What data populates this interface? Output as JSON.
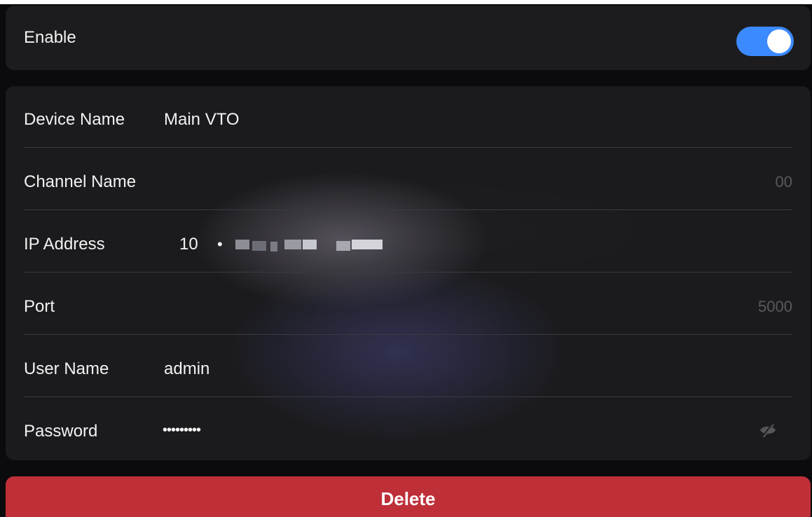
{
  "enable": {
    "label": "Enable",
    "toggle_on": true,
    "toggle_color": "#3b8aff"
  },
  "form": {
    "device_name": {
      "label": "Device Name",
      "value": "Main VTO"
    },
    "channel_name": {
      "label": "Channel Name",
      "value": "",
      "placeholder": "00"
    },
    "ip_address": {
      "label": "IP Address",
      "first_octet": "10",
      "separator": "•"
    },
    "port": {
      "label": "Port",
      "value": "",
      "placeholder": "5000"
    },
    "user_name": {
      "label": "User Name",
      "value": "admin"
    },
    "password": {
      "label": "Password",
      "value": "•••••••••",
      "visibility_icon": "eye-slash-icon"
    }
  },
  "actions": {
    "delete_label": "Delete",
    "delete_color": "#be2f38"
  }
}
